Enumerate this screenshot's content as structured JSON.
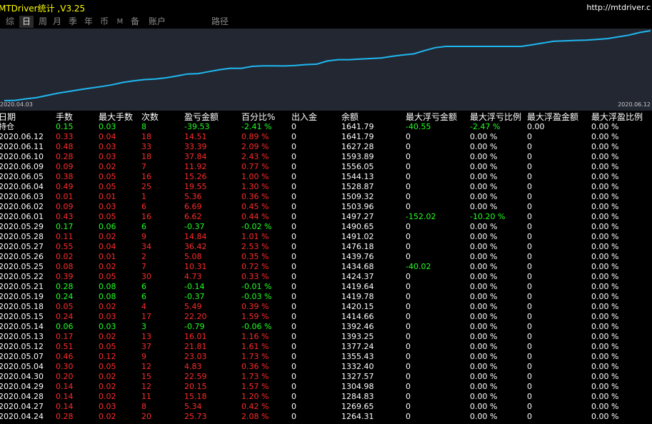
{
  "window": {
    "title": "MTDriver统计 ,V3.25",
    "website": "http://mtdriver.c"
  },
  "tabs": [
    {
      "label": "综",
      "active": false
    },
    {
      "label": "日",
      "active": true
    },
    {
      "label": "周",
      "active": false
    },
    {
      "label": "月",
      "active": false
    },
    {
      "label": "季",
      "active": false
    },
    {
      "label": "年",
      "active": false
    },
    {
      "label": "币",
      "active": false
    },
    {
      "label": "M",
      "active": false
    },
    {
      "label": "备",
      "active": false
    },
    {
      "label": "账户",
      "active": false
    },
    {
      "label": "路径",
      "active": false
    }
  ],
  "chart_data": {
    "type": "line",
    "x_start_label": "2020.04.03",
    "x_end_label": "2020.06.12",
    "line_color": "#1fb8f0",
    "values": [
      1025,
      1028,
      1045,
      1060,
      1085,
      1110,
      1130,
      1150,
      1168,
      1185,
      1205,
      1232,
      1250,
      1264.31,
      1269.65,
      1284.83,
      1304.98,
      1327.57,
      1332.4,
      1355.43,
      1377.24,
      1393.25,
      1392.46,
      1414.66,
      1420.15,
      1419.78,
      1419.64,
      1424.37,
      1434.68,
      1439.76,
      1476.18,
      1491.02,
      1490.65,
      1497.27,
      1503.96,
      1509.32,
      1528.87,
      1544.13,
      1556.05,
      1593.89,
      1627.28,
      1641.79,
      1641.79,
      1641.79,
      1641.79,
      1641.79,
      1641.79,
      1641.79,
      1641.79,
      1660,
      1680,
      1700,
      1705,
      1710,
      1712,
      1720,
      1730,
      1750,
      1770,
      1800,
      1820
    ],
    "grid": false
  },
  "table": {
    "headers": [
      "日期",
      "手数",
      "最大手数",
      "次数",
      "盈亏金额",
      "百分比%",
      "出入金",
      "余额",
      "最大浮亏金额",
      "最大浮亏比例",
      "最大浮盈金额",
      "最大浮盈比例"
    ],
    "rows": [
      {
        "c": [
          "持仓",
          "0.15",
          "0.03",
          "8",
          "-39.53",
          "-2.41 %",
          "0",
          "1641.79",
          "-40.55",
          "-2.47 %",
          "0.00",
          "0.00 %"
        ],
        "tone": "green"
      },
      {
        "c": [
          "2020.06.12",
          "0.33",
          "0.04",
          "18",
          "14.51",
          "0.89 %",
          "0",
          "1641.79",
          "0",
          "0.00 %",
          "0",
          "0.00 %"
        ],
        "tone": "red"
      },
      {
        "c": [
          "2020.06.11",
          "0.48",
          "0.03",
          "33",
          "33.39",
          "2.09 %",
          "0",
          "1627.28",
          "0",
          "0.00 %",
          "0",
          "0.00 %"
        ],
        "tone": "red"
      },
      {
        "c": [
          "2020.06.10",
          "0.28",
          "0.03",
          "18",
          "37.84",
          "2.43 %",
          "0",
          "1593.89",
          "0",
          "0.00 %",
          "0",
          "0.00 %"
        ],
        "tone": "red"
      },
      {
        "c": [
          "2020.06.09",
          "0.09",
          "0.02",
          "7",
          "11.92",
          "0.77 %",
          "0",
          "1556.05",
          "0",
          "0.00 %",
          "0",
          "0.00 %"
        ],
        "tone": "red"
      },
      {
        "c": [
          "2020.06.05",
          "0.38",
          "0.05",
          "16",
          "15.26",
          "1.00 %",
          "0",
          "1544.13",
          "0",
          "0.00 %",
          "0",
          "0.00 %"
        ],
        "tone": "red"
      },
      {
        "c": [
          "2020.06.04",
          "0.49",
          "0.05",
          "25",
          "19.55",
          "1.30 %",
          "0",
          "1528.87",
          "0",
          "0.00 %",
          "0",
          "0.00 %"
        ],
        "tone": "red"
      },
      {
        "c": [
          "2020.06.03",
          "0.01",
          "0.01",
          "1",
          "5.36",
          "0.36 %",
          "0",
          "1509.32",
          "0",
          "0.00 %",
          "0",
          "0.00 %"
        ],
        "tone": "red"
      },
      {
        "c": [
          "2020.06.02",
          "0.09",
          "0.03",
          "6",
          "6.69",
          "0.45 %",
          "0",
          "1503.96",
          "0",
          "0.00 %",
          "0",
          "0.00 %"
        ],
        "tone": "red"
      },
      {
        "c": [
          "2020.06.01",
          "0.43",
          "0.05",
          "16",
          "6.62",
          "0.44 %",
          "0",
          "1497.27",
          "-152.02",
          "-10.20 %",
          "0",
          "0.00 %"
        ],
        "tone": "red"
      },
      {
        "c": [
          "2020.05.29",
          "0.17",
          "0.06",
          "6",
          "-0.37",
          "-0.02 %",
          "0",
          "1490.65",
          "0",
          "0.00 %",
          "0",
          "0.00 %"
        ],
        "tone": "green"
      },
      {
        "c": [
          "2020.05.28",
          "0.11",
          "0.02",
          "9",
          "14.84",
          "1.01 %",
          "0",
          "1491.02",
          "0",
          "0.00 %",
          "0",
          "0.00 %"
        ],
        "tone": "red"
      },
      {
        "c": [
          "2020.05.27",
          "0.55",
          "0.04",
          "34",
          "36.42",
          "2.53 %",
          "0",
          "1476.18",
          "0",
          "0.00 %",
          "0",
          "0.00 %"
        ],
        "tone": "red"
      },
      {
        "c": [
          "2020.05.26",
          "0.02",
          "0.01",
          "2",
          "5.08",
          "0.35 %",
          "0",
          "1439.76",
          "0",
          "0.00 %",
          "0",
          "0.00 %"
        ],
        "tone": "red"
      },
      {
        "c": [
          "2020.05.25",
          "0.08",
          "0.02",
          "7",
          "10.31",
          "0.72 %",
          "0",
          "1434.68",
          "-40.02",
          "0.00 %",
          "0",
          "0.00 %"
        ],
        "tone": "red"
      },
      {
        "c": [
          "2020.05.22",
          "0.39",
          "0.05",
          "30",
          "4.73",
          "0.33 %",
          "0",
          "1424.37",
          "0",
          "0.00 %",
          "0",
          "0.00 %"
        ],
        "tone": "red"
      },
      {
        "c": [
          "2020.05.21",
          "0.28",
          "0.08",
          "6",
          "-0.14",
          "-0.01 %",
          "0",
          "1419.64",
          "0",
          "0.00 %",
          "0",
          "0.00 %"
        ],
        "tone": "green"
      },
      {
        "c": [
          "2020.05.19",
          "0.24",
          "0.08",
          "6",
          "-0.37",
          "-0.03 %",
          "0",
          "1419.78",
          "0",
          "0.00 %",
          "0",
          "0.00 %"
        ],
        "tone": "green"
      },
      {
        "c": [
          "2020.05.18",
          "0.05",
          "0.02",
          "4",
          "5.49",
          "0.39 %",
          "0",
          "1420.15",
          "0",
          "0.00 %",
          "0",
          "0.00 %"
        ],
        "tone": "red"
      },
      {
        "c": [
          "2020.05.15",
          "0.24",
          "0.03",
          "17",
          "22.20",
          "1.59 %",
          "0",
          "1414.66",
          "0",
          "0.00 %",
          "0",
          "0.00 %"
        ],
        "tone": "red"
      },
      {
        "c": [
          "2020.05.14",
          "0.06",
          "0.03",
          "3",
          "-0.79",
          "-0.06 %",
          "0",
          "1392.46",
          "0",
          "0.00 %",
          "0",
          "0.00 %"
        ],
        "tone": "green"
      },
      {
        "c": [
          "2020.05.13",
          "0.17",
          "0.02",
          "13",
          "16.01",
          "1.16 %",
          "0",
          "1393.25",
          "0",
          "0.00 %",
          "0",
          "0.00 %"
        ],
        "tone": "red"
      },
      {
        "c": [
          "2020.05.12",
          "0.51",
          "0.05",
          "37",
          "21.81",
          "1.61 %",
          "0",
          "1377.24",
          "0",
          "0.00 %",
          "0",
          "0.00 %"
        ],
        "tone": "red"
      },
      {
        "c": [
          "2020.05.07",
          "0.46",
          "0.12",
          "9",
          "23.03",
          "1.73 %",
          "0",
          "1355.43",
          "0",
          "0.00 %",
          "0",
          "0.00 %"
        ],
        "tone": "red"
      },
      {
        "c": [
          "2020.05.04",
          "0.30",
          "0.05",
          "12",
          "4.83",
          "0.36 %",
          "0",
          "1332.40",
          "0",
          "0.00 %",
          "0",
          "0.00 %"
        ],
        "tone": "red"
      },
      {
        "c": [
          "2020.04.30",
          "0.20",
          "0.02",
          "15",
          "22.59",
          "1.73 %",
          "0",
          "1327.57",
          "0",
          "0.00 %",
          "0",
          "0.00 %"
        ],
        "tone": "red"
      },
      {
        "c": [
          "2020.04.29",
          "0.14",
          "0.02",
          "12",
          "20.15",
          "1.57 %",
          "0",
          "1304.98",
          "0",
          "0.00 %",
          "0",
          "0.00 %"
        ],
        "tone": "red"
      },
      {
        "c": [
          "2020.04.28",
          "0.14",
          "0.02",
          "11",
          "15.18",
          "1.20 %",
          "0",
          "1284.83",
          "0",
          "0.00 %",
          "0",
          "0.00 %"
        ],
        "tone": "red"
      },
      {
        "c": [
          "2020.04.27",
          "0.14",
          "0.03",
          "8",
          "5.34",
          "0.42 %",
          "0",
          "1269.65",
          "0",
          "0.00 %",
          "0",
          "0.00 %"
        ],
        "tone": "red"
      },
      {
        "c": [
          "2020.04.24",
          "0.28",
          "0.02",
          "20",
          "25.73",
          "2.08 %",
          "0",
          "1264.31",
          "0",
          "0.00 %",
          "0",
          "0.00 %"
        ],
        "tone": "red"
      }
    ]
  }
}
